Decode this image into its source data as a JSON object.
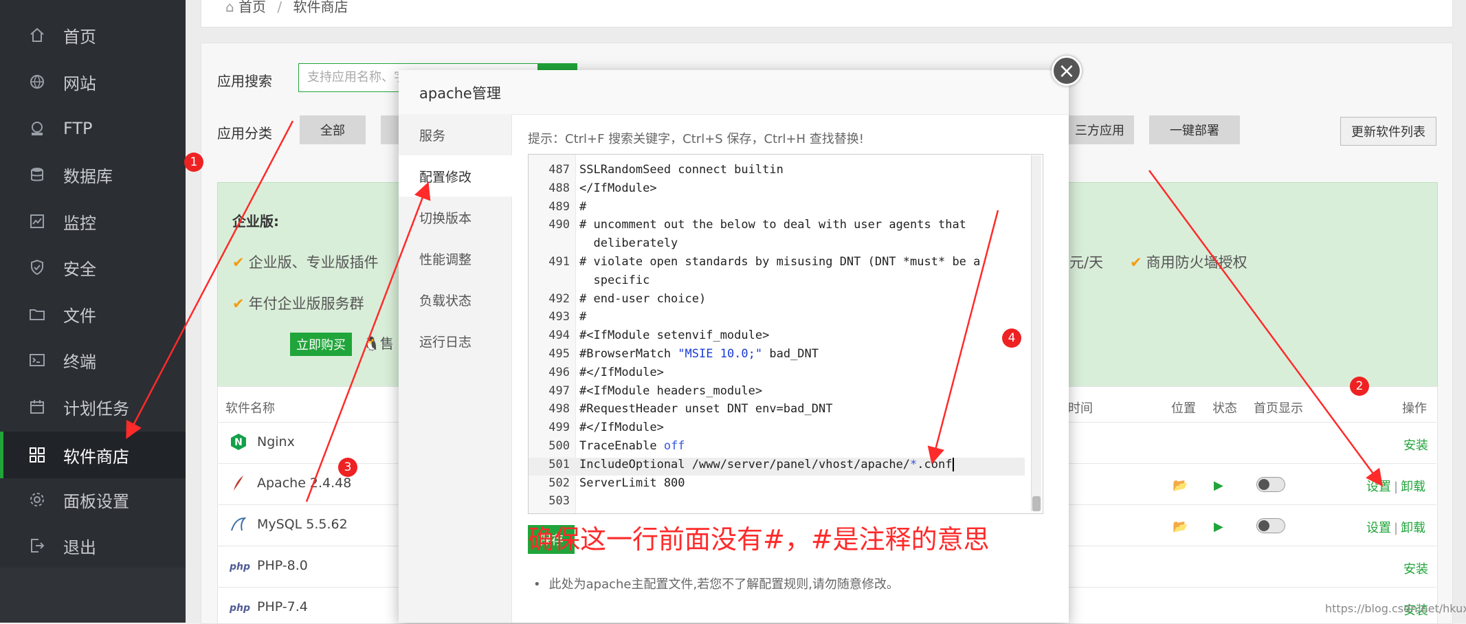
{
  "sidebar": {
    "items": [
      {
        "label": "首页",
        "icon": "home-icon"
      },
      {
        "label": "网站",
        "icon": "globe-icon"
      },
      {
        "label": "FTP",
        "icon": "ftp-icon"
      },
      {
        "label": "数据库",
        "icon": "database-icon"
      },
      {
        "label": "监控",
        "icon": "monitor-icon"
      },
      {
        "label": "安全",
        "icon": "shield-icon"
      },
      {
        "label": "文件",
        "icon": "folder-icon"
      },
      {
        "label": "终端",
        "icon": "terminal-icon"
      },
      {
        "label": "计划任务",
        "icon": "calendar-icon"
      },
      {
        "label": "软件商店",
        "icon": "grid-icon",
        "active": true
      },
      {
        "label": "面板设置",
        "icon": "gear-icon"
      },
      {
        "label": "退出",
        "icon": "logout-icon"
      }
    ]
  },
  "breadcrumb": {
    "home": "首页",
    "sep": "/",
    "current": "软件商店"
  },
  "store": {
    "search_label": "应用搜索",
    "search_placeholder": "支持应用名称、字",
    "category_label": "应用分类",
    "categories": [
      "全部",
      "三方应用",
      "一键部署"
    ],
    "update_button": "更新软件列表"
  },
  "enterprise": {
    "title": "企业版:",
    "features": [
      "企业版、专业版插件",
      "年付企业版服务群",
      "元/天",
      "商用防火墙授权"
    ],
    "buy_button": "立即购买",
    "qq_text": "售"
  },
  "table": {
    "headers": [
      "软件名称",
      "时间",
      "位置",
      "状态",
      "首页显示",
      "操作"
    ],
    "rows": [
      {
        "name": "Nginx",
        "icon": "nginx-icon",
        "action_install": "安装"
      },
      {
        "name": "Apache 2.4.48",
        "icon": "apache-feather-icon",
        "action_settings": "设置",
        "action_uninstall": "卸载"
      },
      {
        "name": "MySQL 5.5.62",
        "icon": "mysql-dolphin-icon",
        "action_settings": "设置",
        "action_uninstall": "卸载"
      },
      {
        "name": "PHP-8.0",
        "icon": "php-icon",
        "action_install": "安装"
      },
      {
        "name": "PHP-7.4",
        "icon": "php-icon",
        "action_install": "安装"
      }
    ],
    "sep": "|"
  },
  "modal": {
    "title": "apache管理",
    "close": "×",
    "tabs": [
      "服务",
      "配置修改",
      "切换版本",
      "性能调整",
      "负载状态",
      "运行日志"
    ],
    "active_tab": "配置修改",
    "tip": "提示：Ctrl+F 搜索关键字，Ctrl+S 保存，Ctrl+H 查找替换!",
    "save_button": "保存",
    "note": "此处为apache主配置文件,若您不了解配置规则,请勿随意修改。",
    "editor_lines": [
      {
        "n": "487",
        "t": "SSLRandomSeed connect builtin"
      },
      {
        "n": "488",
        "t": "</IfModule>"
      },
      {
        "n": "489",
        "t": "#"
      },
      {
        "n": "490",
        "t": "# uncomment out the below to deal with user agents that"
      },
      {
        "n": "",
        "t": "  deliberately"
      },
      {
        "n": "491",
        "t": "# violate open standards by misusing DNT (DNT *must* be a"
      },
      {
        "n": "",
        "t": "  specific"
      },
      {
        "n": "492",
        "t": "# end-user choice)"
      },
      {
        "n": "493",
        "t": "#"
      },
      {
        "n": "494",
        "t": "#<IfModule setenvif_module>"
      },
      {
        "n": "495",
        "t": "#BrowserMatch \"MSIE 10.0;\" bad_DNT"
      },
      {
        "n": "496",
        "t": "#</IfModule>"
      },
      {
        "n": "497",
        "t": "#<IfModule headers_module>"
      },
      {
        "n": "498",
        "t": "#RequestHeader unset DNT env=bad_DNT"
      },
      {
        "n": "499",
        "t": "#</IfModule>"
      },
      {
        "n": "500",
        "t": "TraceEnable off"
      },
      {
        "n": "501",
        "t": "IncludeOptional /www/server/panel/vhost/apache/*.conf"
      },
      {
        "n": "502",
        "t": "ServerLimit 800"
      },
      {
        "n": "503",
        "t": ""
      }
    ]
  },
  "annotation": {
    "text": "确保这一行前面没有#，#是注释的意思",
    "badges": [
      "1",
      "2",
      "3",
      "4"
    ],
    "color": "#ff2a2a"
  },
  "watermark": "https://blog.csdn.net/hkuxia",
  "colors": {
    "accent": "#20a53a",
    "sidebar": "#2b2e33"
  }
}
